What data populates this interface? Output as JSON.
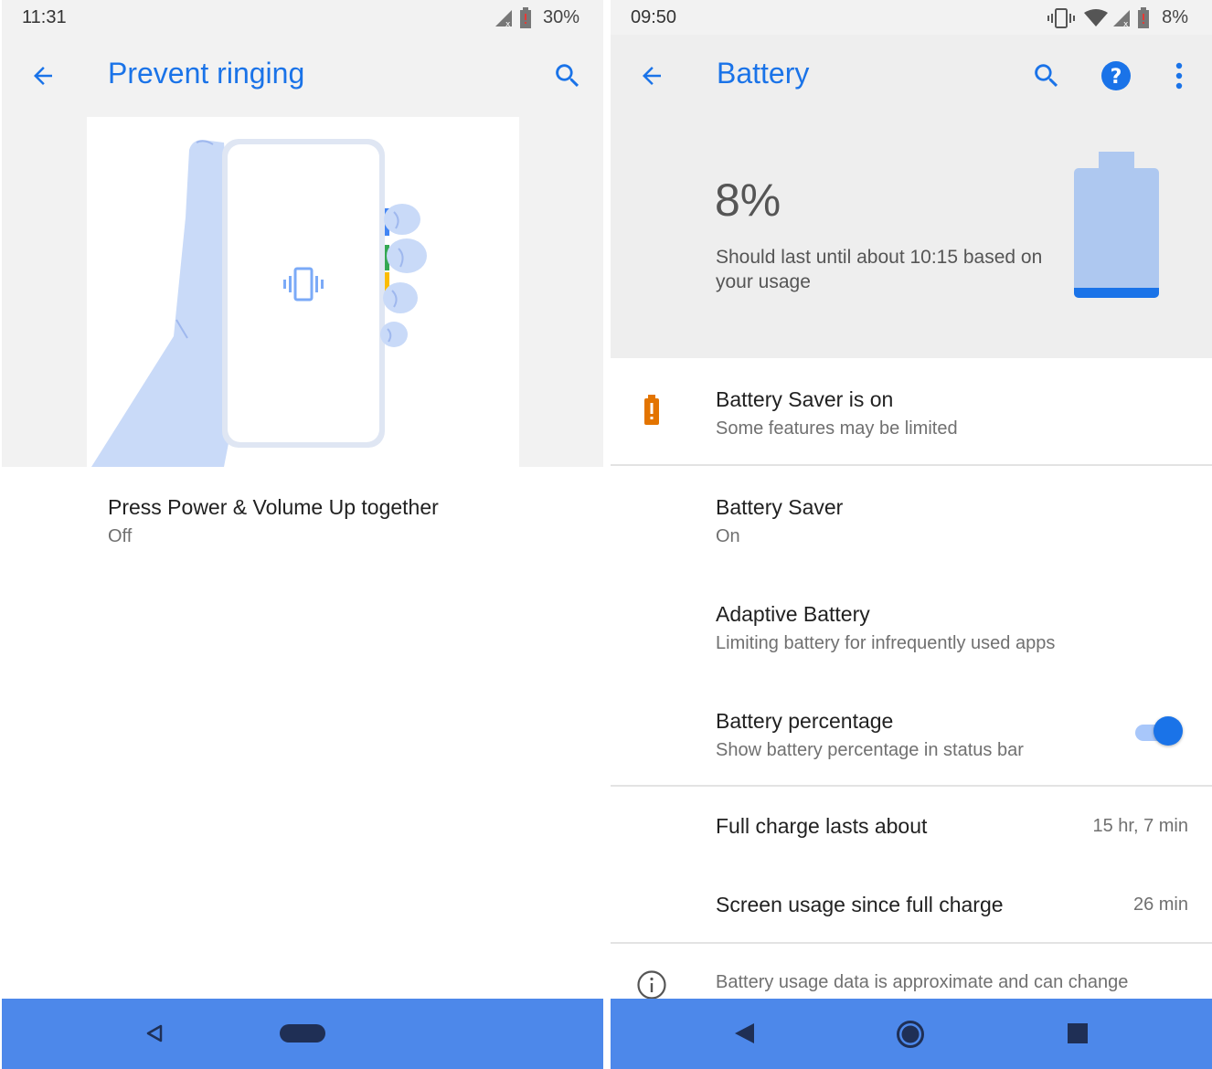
{
  "left_screen": {
    "status_bar": {
      "time": "11:31",
      "battery_percent": "30%"
    },
    "app_bar": {
      "title": "Prevent ringing"
    },
    "setting": {
      "title": "Press Power & Volume Up together",
      "value": "Off"
    }
  },
  "right_screen": {
    "status_bar": {
      "time": "09:50",
      "battery_percent": "8%"
    },
    "app_bar": {
      "title": "Battery"
    },
    "header": {
      "percent": "8%",
      "estimate": "Should last until about 10:15 based on your usage",
      "battery_level": 0.08
    },
    "items": [
      {
        "title": "Battery Saver is on",
        "subtitle": "Some features may be limited"
      },
      {
        "title": "Battery Saver",
        "subtitle": "On"
      },
      {
        "title": "Adaptive Battery",
        "subtitle": "Limiting battery for infrequently used apps"
      },
      {
        "title": "Battery percentage",
        "subtitle": "Show battery percentage in status bar",
        "toggle": true
      }
    ],
    "stats": [
      {
        "label": "Full charge lasts about",
        "value": "15 hr, 7 min"
      },
      {
        "label": "Screen usage since full charge",
        "value": "26 min"
      }
    ],
    "footer": {
      "info": "Battery usage data is approximate and can change"
    }
  },
  "colors": {
    "accent": "#1a73e8",
    "navbar": "#4d88ea",
    "warning": "#e37400"
  }
}
